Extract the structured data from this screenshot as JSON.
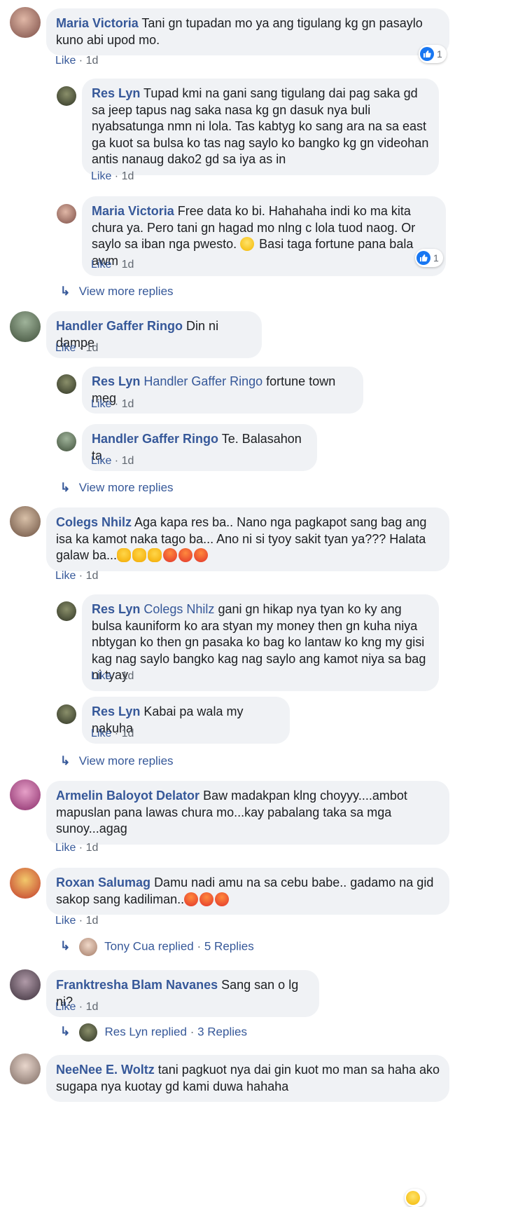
{
  "ui": {
    "like": "Like",
    "sep": " · ",
    "time": "1d",
    "view_more": "View more replies"
  },
  "comments": {
    "c1": {
      "name": "Maria Victoria",
      "text": "Tani gn tupadan mo ya ang tigulang kg gn pasaylo kuno abi upod mo.",
      "reactions": "1"
    },
    "r1": {
      "name": "Res Lyn",
      "text": "Tupad kmi na gani sang tigulang dai pag saka gd sa jeep tapus nag saka nasa kg gn dasuk nya buli nyabsatunga nmn ni lola. Tas kabtyg ko sang ara na sa east ga kuot sa bulsa ko tas nag saylo ko bangko kg gn videohan antis nanaug dako2 gd sa iya as in"
    },
    "r2": {
      "name": "Maria Victoria",
      "text": "Free data ko bi. Hahahaha indi ko ma kita chura ya. Pero tani gn hagad mo nlng c lola tuod naog. Or saylo sa iban nga pwesto.",
      "text2": "Basi taga fortune pana bala awm",
      "reactions": "1"
    },
    "c2": {
      "name": "Handler Gaffer Ringo",
      "text": "Din ni dampe"
    },
    "r3": {
      "name": "Res Lyn",
      "tag": "Handler Gaffer Ringo",
      "text": "fortune town meg"
    },
    "r4": {
      "name": "Handler Gaffer Ringo",
      "text": "Te. Balasahon ta"
    },
    "c3": {
      "name": "Colegs Nhilz",
      "text": "Aga kapa res ba.. Nano nga pagkapot sang bag ang isa ka kamot naka tago ba... Ano ni si tyoy sakit tyan ya??? Halata galaw ba..."
    },
    "r5": {
      "name": "Res Lyn",
      "tag": "Colegs Nhilz",
      "text": "gani gn hikap nya tyan ko ky ang bulsa kauniform ko ara styan my money then gn kuha niya nbtygan ko then gn pasaka ko bag ko lantaw ko kng my gisi kag nag saylo bangko kag nag saylo ang kamot niya sa bag ni tyay"
    },
    "r6": {
      "name": "Res Lyn",
      "text": "Kabai pa wala my nakuha"
    },
    "c4": {
      "name": "Armelin Baloyot Delator",
      "text": "Baw madakpan klng choyyy....ambot mapuslan pana lawas chura mo...kay pabalang taka sa mga sunoy...agag"
    },
    "c5": {
      "name": "Roxan Salumag",
      "text": "Damu nadi amu na sa cebu babe.. gadamo na gid sakop sang kadiliman.."
    },
    "c5r": {
      "who": "Tony Cua replied",
      "count": "5 Replies"
    },
    "c6": {
      "name": "Franktresha Blam Navanes",
      "text": "Sang san o lg ni?"
    },
    "c6r": {
      "who": "Res Lyn replied",
      "count": "3 Replies"
    },
    "c7": {
      "name": "NeeNee E. Woltz",
      "text": "tani pagkuot nya dai gin kuot mo man sa haha ako sugapa nya kuotay gd kami duwa hahaha"
    }
  },
  "colors": {
    "link": "#365899",
    "bubble": "#f0f2f5",
    "meta": "#606770",
    "like_blue": "#1877f2"
  }
}
